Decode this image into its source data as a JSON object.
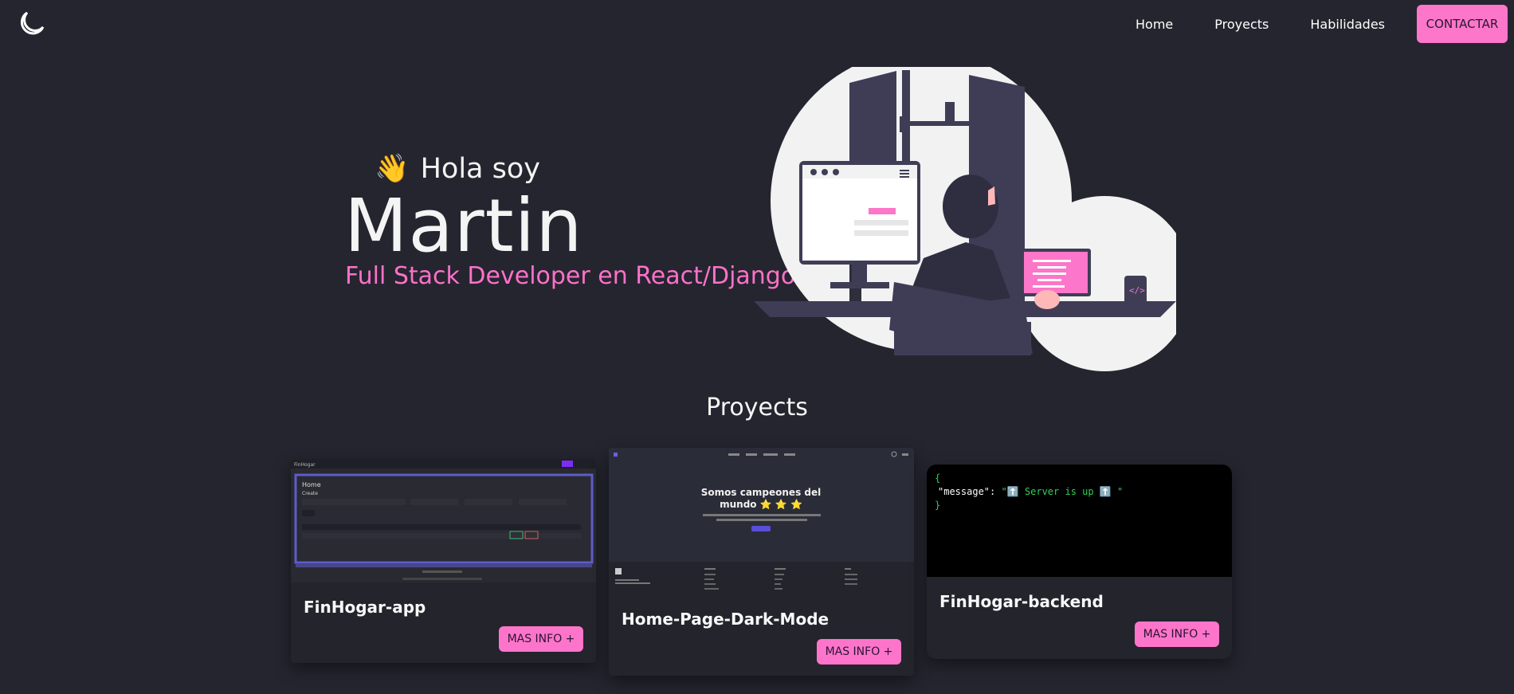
{
  "nav": {
    "links": [
      "Home",
      "Proyects",
      "Habilidades"
    ],
    "contact_label": "CONTACTAR"
  },
  "hero": {
    "greeting": "Hola soy",
    "name": "Martin",
    "role": "Full Stack Developer en React/Django"
  },
  "projects": {
    "title": "Proyects",
    "cards": [
      {
        "title": "FinHogar-app",
        "button": "MAS INFO +",
        "preview_text": [
          "FinHogar",
          "Home",
          "Create"
        ]
      },
      {
        "title": "Home-Page-Dark-Mode",
        "button": "MAS INFO +",
        "preview_text": [
          "Somos campeones del",
          "mundo ⭐ ⭐ ⭐"
        ]
      },
      {
        "title": "FinHogar-backend",
        "button": "MAS INFO +",
        "json_key": "\"message\"",
        "json_value": "\"⬆️ Server is up ⬆️ \""
      }
    ]
  },
  "colors": {
    "background": "#25252f",
    "accent": "#fd75cb"
  }
}
